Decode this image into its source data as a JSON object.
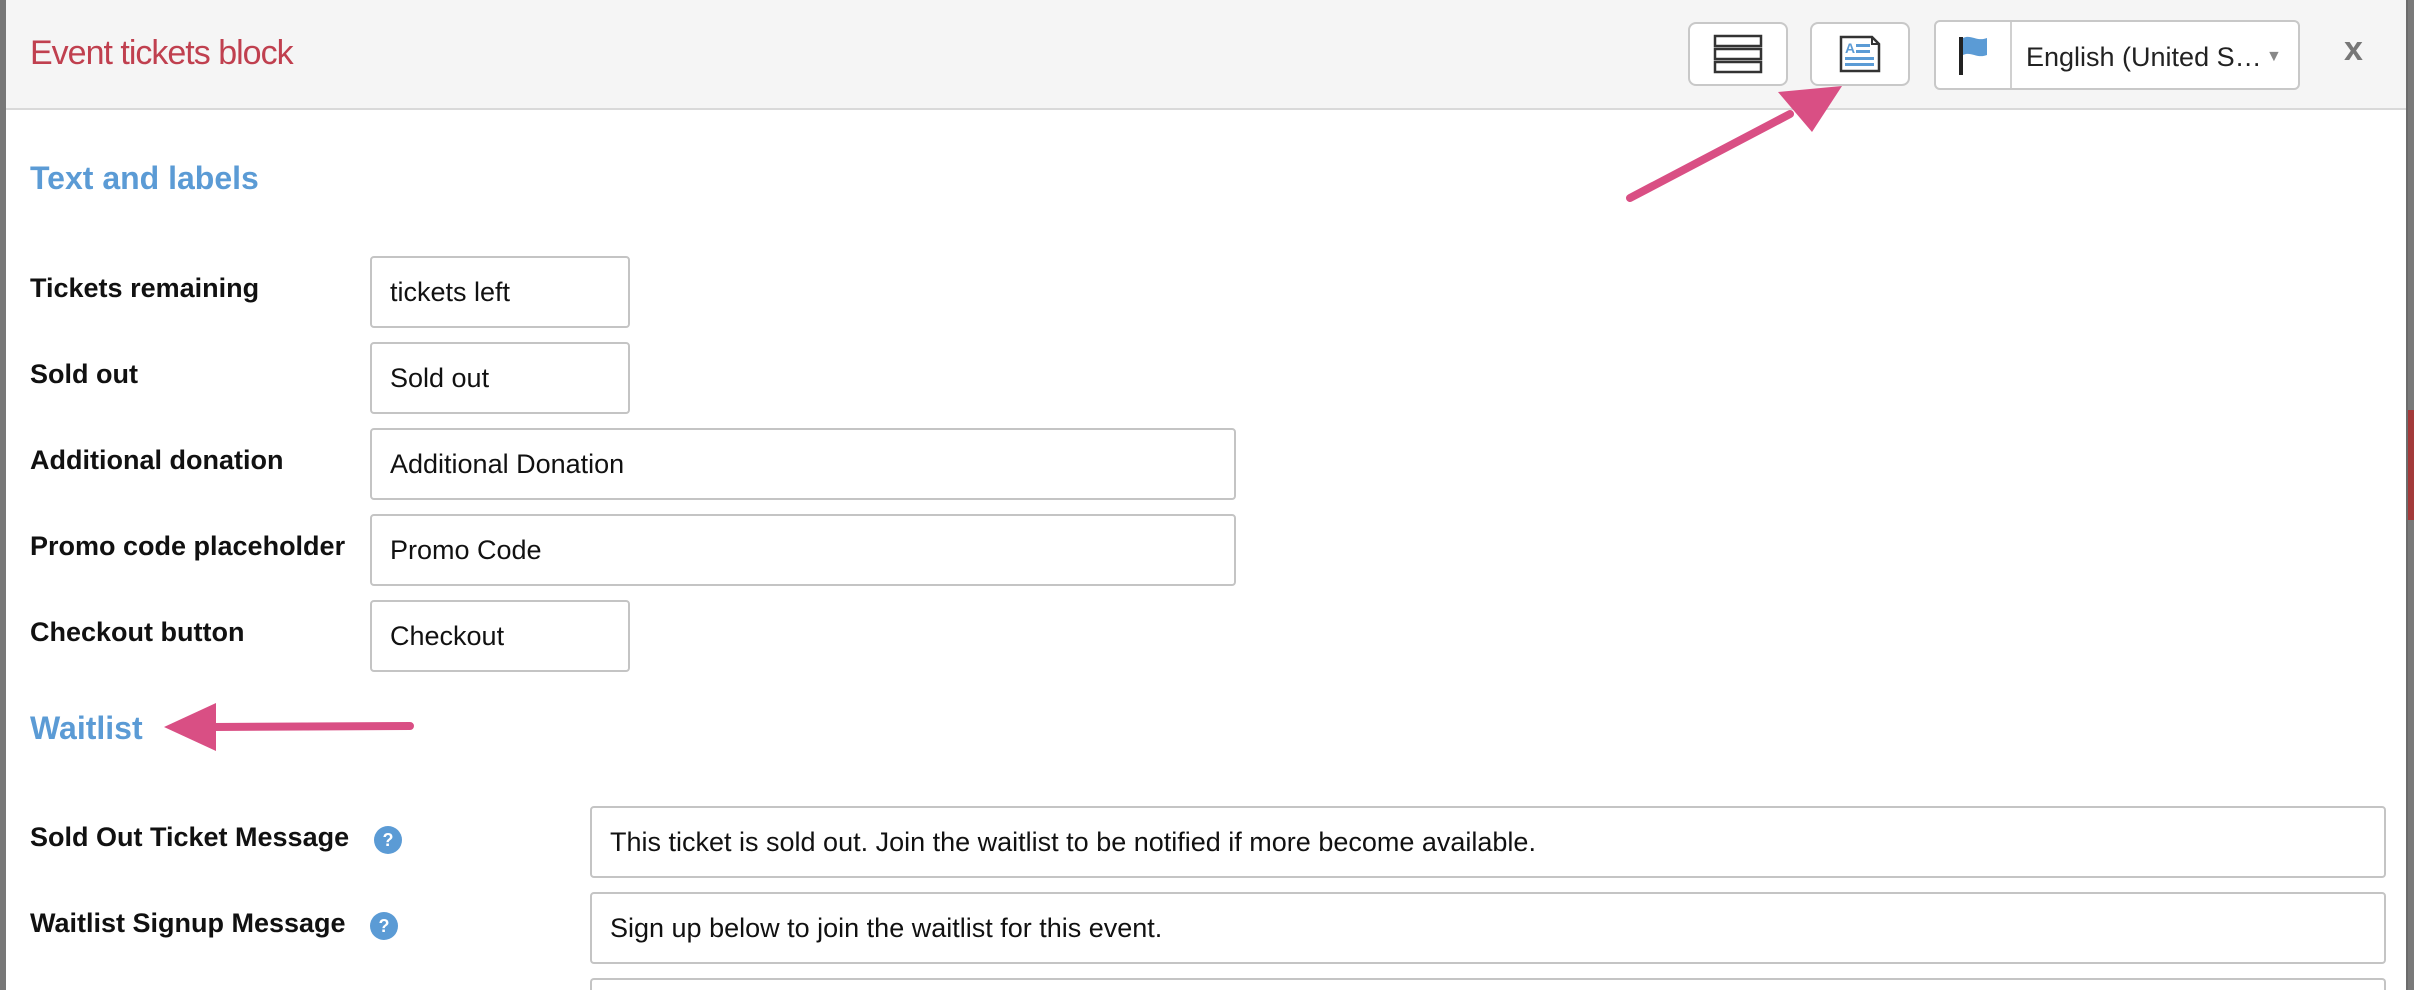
{
  "modal": {
    "title": "Event tickets block",
    "close_label": "x",
    "language": {
      "selected": "English (United S…"
    }
  },
  "sections": {
    "text_and_labels": {
      "heading": "Text and labels",
      "fields": {
        "tickets_remaining": {
          "label": "Tickets remaining",
          "value": "tickets left"
        },
        "sold_out": {
          "label": "Sold out",
          "value": "Sold out"
        },
        "additional_donation": {
          "label": "Additional donation",
          "value": "Additional Donation"
        },
        "promo_code": {
          "label": "Promo code placeholder",
          "value": "Promo Code"
        },
        "checkout_button": {
          "label": "Checkout button",
          "value": "Checkout"
        }
      }
    },
    "waitlist": {
      "heading": "Waitlist",
      "fields": {
        "sold_out_message": {
          "label": "Sold Out Ticket Message",
          "value": "This ticket is sold out. Join the waitlist to be notified if more become available."
        },
        "signup_message": {
          "label": "Waitlist Signup Message",
          "value": "Sign up below to join the waitlist for this event."
        }
      }
    }
  },
  "icons": {
    "help": "?",
    "rows_view": "list-rows-icon",
    "doc_view": "document-icon",
    "flag": "flag-icon"
  },
  "colors": {
    "title": "#c0404f",
    "heading": "#5b9bd5",
    "annotation_arrow": "#d94f84"
  }
}
